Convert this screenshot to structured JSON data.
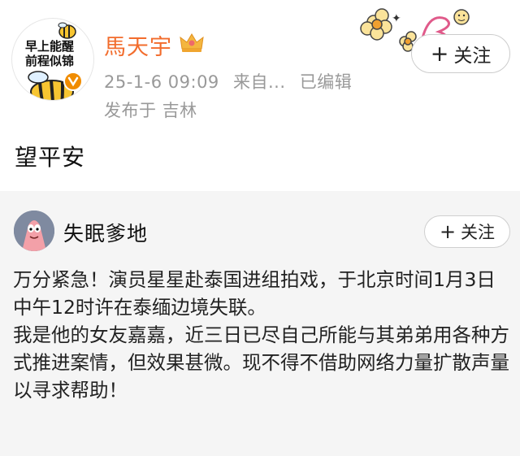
{
  "post": {
    "avatar_text_line1": "早上能醒",
    "avatar_text_line2": "前程似锦",
    "username": "馬天宇",
    "timestamp": "25-1-6 09:09",
    "source": "来自...",
    "edited": "已编辑",
    "location": "发布于 吉林",
    "follow_label": "关注",
    "follow_symbol": "+",
    "text": "望平安"
  },
  "repost": {
    "username": "失眠爹地",
    "follow_label": "关注",
    "follow_symbol": "+",
    "paragraph1": "万分紧急！演员星星赴泰国进组拍戏，于北京时间1月3日中午12时许在泰缅边境失联。",
    "paragraph2": "我是他的女友嘉嘉，近三日已尽自己所能与其弟弟用各种方式推进案情，但效果甚微。现不得不借助网络力量扩散声量以寻求帮助！"
  },
  "colors": {
    "username_accent": "#f26c2c",
    "meta_gray": "#999999",
    "repost_bg": "#f5f5f5",
    "verified_badge": "#f08c00"
  },
  "icons": [
    "bee-avatar-icon",
    "crown-icon",
    "verified-badge-icon",
    "flower-sticker-decoration",
    "plus-icon"
  ]
}
